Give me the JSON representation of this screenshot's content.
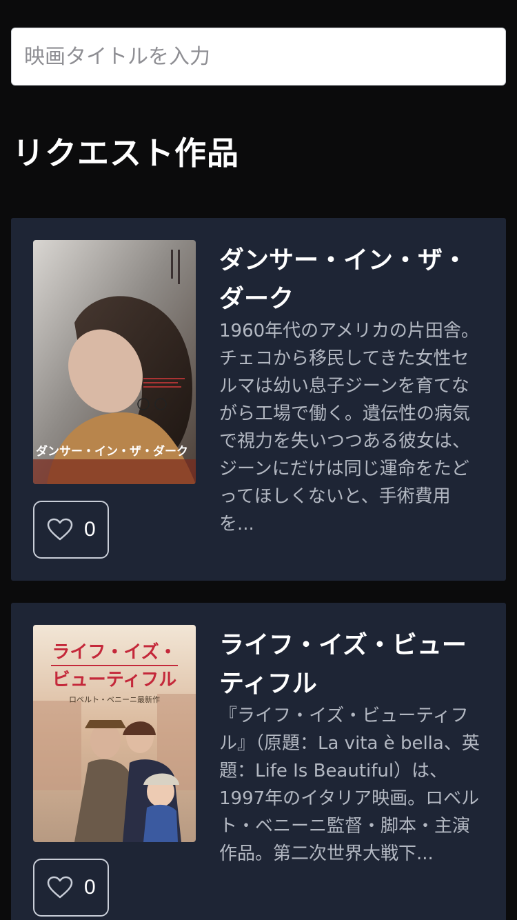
{
  "search": {
    "placeholder": "映画タイトルを入力",
    "value": ""
  },
  "section": {
    "title": "リクエスト作品"
  },
  "movies": [
    {
      "title": "ダンサー・イン・ザ・ダーク",
      "description": "1960年代のアメリカの片田舎。チェコから移民してきた女性セルマは幼い息子ジーンを育てながら工場で働く。遺伝性の病気で視力を失いつつある彼女は、ジーンにだけは同じ運命をたどってほしくないと、手術費用を...",
      "likes": "0",
      "poster_text": "ダンサー・イン・ザ・ダーク"
    },
    {
      "title": "ライフ・イズ・ビューティフル",
      "description": "『ライフ・イズ・ビューティフル』（原題：La vita è bella、英題：Life Is Beautiful）は、1997年のイタリア映画。ロベルト・ベニーニ監督・脚本・主演作品。第二次世界大戦下...",
      "likes": "0",
      "poster_text_line1": "ライフ・イズ・",
      "poster_text_line2": "ビューティフル",
      "poster_subtext": "ロベルト・ベニーニ最新作"
    }
  ],
  "colors": {
    "background": "#0b0b0c",
    "card": "#1e2535",
    "text_primary": "#ffffff",
    "text_secondary": "#b3b8c2"
  },
  "icons": {
    "like": "heart-outline-icon"
  }
}
